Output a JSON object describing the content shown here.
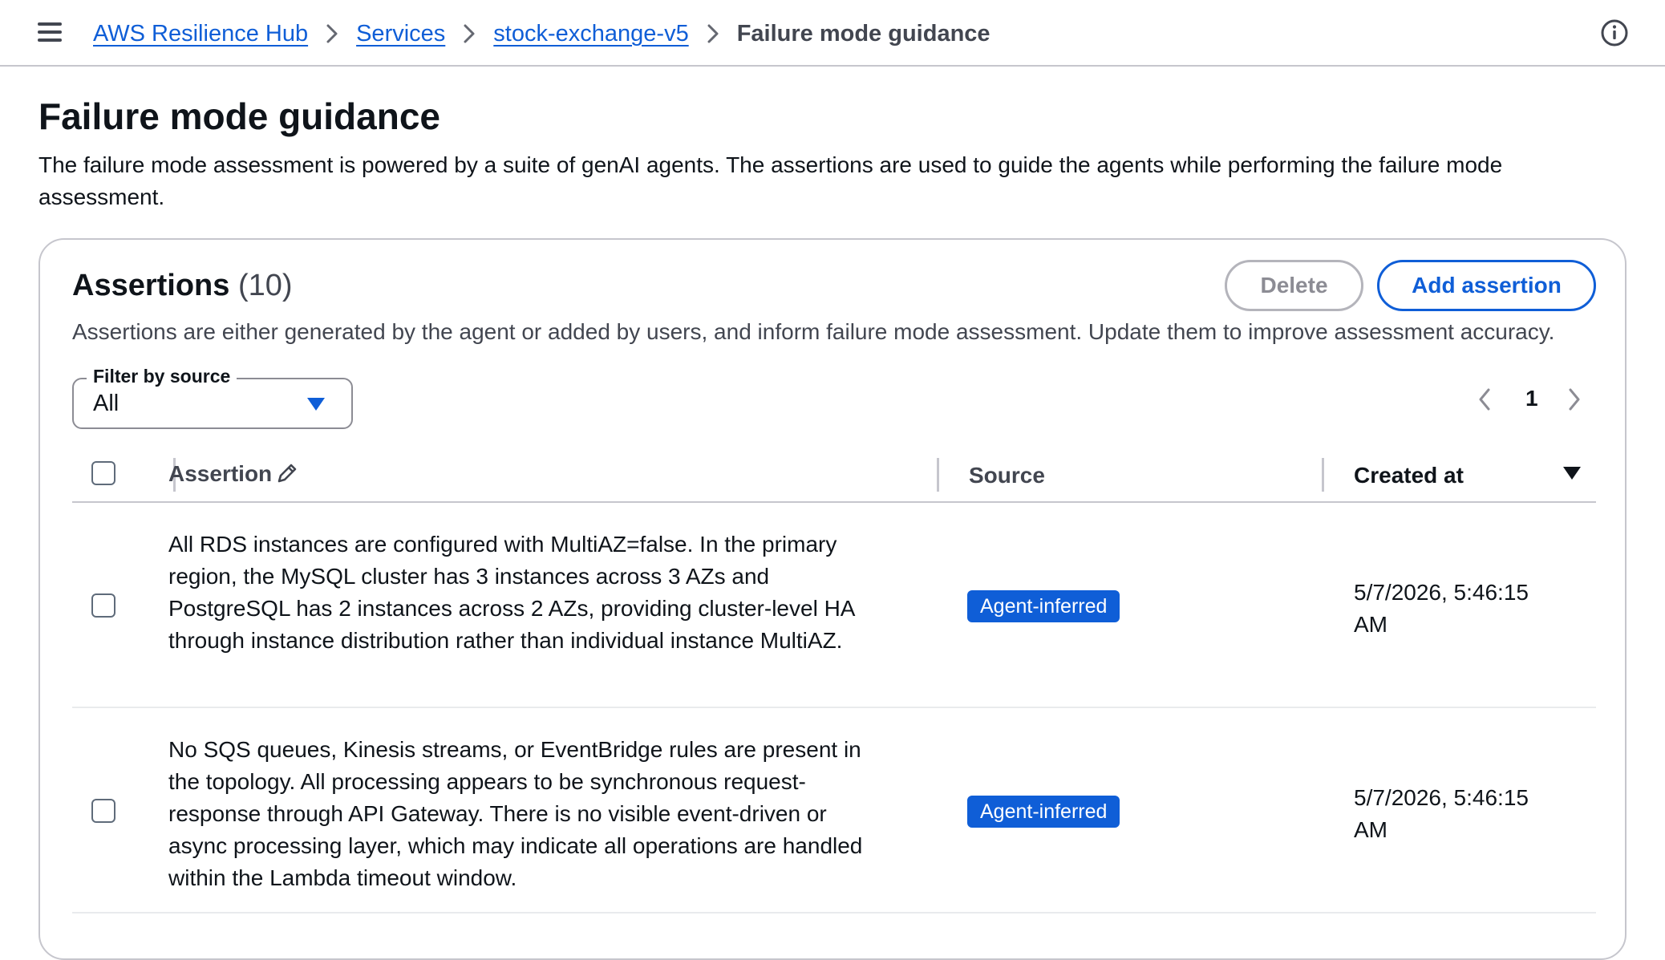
{
  "breadcrumb": {
    "items": [
      "AWS Resilience Hub",
      "Services",
      "stock-exchange-v5"
    ],
    "current": "Failure mode guidance"
  },
  "page": {
    "title": "Failure mode guidance",
    "description": "The failure mode assessment is powered by a suite of genAI agents. The assertions are used to guide the agents while performing the failure mode assessment."
  },
  "assertions_panel": {
    "title": "Assertions",
    "count": "(10)",
    "delete_label": "Delete",
    "add_label": "Add assertion",
    "description": "Assertions are either generated by the agent or added by users, and inform failure mode assessment. Update them to improve assessment accuracy.",
    "filter": {
      "label": "Filter by source",
      "value": "All"
    },
    "pagination": {
      "current_page": "1"
    },
    "columns": {
      "assertion": "Assertion",
      "source": "Source",
      "created_at": "Created at"
    },
    "rows": [
      {
        "assertion": "All RDS instances are configured with MultiAZ=false. In the primary region, the MySQL cluster has 3 instances across 3 AZs and PostgreSQL has 2 instances across 2 AZs, providing cluster-level HA through instance distribution rather than individual instance MultiAZ.",
        "source": "Agent-inferred",
        "created_at": "5/7/2026, 5:46:15 AM"
      },
      {
        "assertion": "No SQS queues, Kinesis streams, or EventBridge rules are present in the topology. All processing appears to be synchronous request-response through API Gateway. There is no visible event-driven or async processing layer, which may indicate all operations are handled within the Lambda timeout window.",
        "source": "Agent-inferred",
        "created_at": "5/7/2026, 5:46:15 AM"
      }
    ]
  },
  "colors": {
    "link": "#0f5ed7",
    "badge_bg": "#0f5ed7",
    "text": "#0f141a",
    "muted": "#424650",
    "border": "#c6c6cd"
  },
  "icons": [
    "menu-icon",
    "chevron-right-icon",
    "info-icon",
    "pencil-icon",
    "caret-down-icon",
    "chevron-left-icon",
    "sort-descending-icon"
  ]
}
